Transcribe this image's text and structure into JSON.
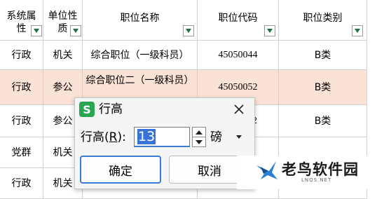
{
  "table": {
    "headers": {
      "col1": "系统属性",
      "col2": "单位性质",
      "col3": "职位名称",
      "col4": "职位代码",
      "col5": "职位类别"
    },
    "rows": [
      {
        "sys": "行政",
        "unit": "机关",
        "name": "综合职位（一级科员）",
        "code": "45050044",
        "cat": "B类"
      },
      {
        "sys": "行政",
        "unit": "参公",
        "name": "综合职位二（一级科员）",
        "code": "45050052",
        "cat": "B类"
      },
      {
        "sys": "行政",
        "unit": "参公",
        "name": "",
        "code": "2",
        "cat": "B类"
      },
      {
        "sys": "党群",
        "unit": "机关",
        "name": "",
        "code": "",
        "cat": ""
      },
      {
        "sys": "行政",
        "unit": "机关",
        "name": "",
        "code": "",
        "cat": ""
      }
    ],
    "highlight_color": "#fbe2d6"
  },
  "dialog": {
    "logo": "S",
    "title": "行高",
    "field_label_prefix": "行高(",
    "field_label_key": "R",
    "field_label_suffix": "):",
    "value": "13",
    "unit": "磅",
    "ok": "确定",
    "cancel": "取消"
  },
  "watermark": {
    "text": "老鸟软件园",
    "sub": "LNQS.NET"
  }
}
